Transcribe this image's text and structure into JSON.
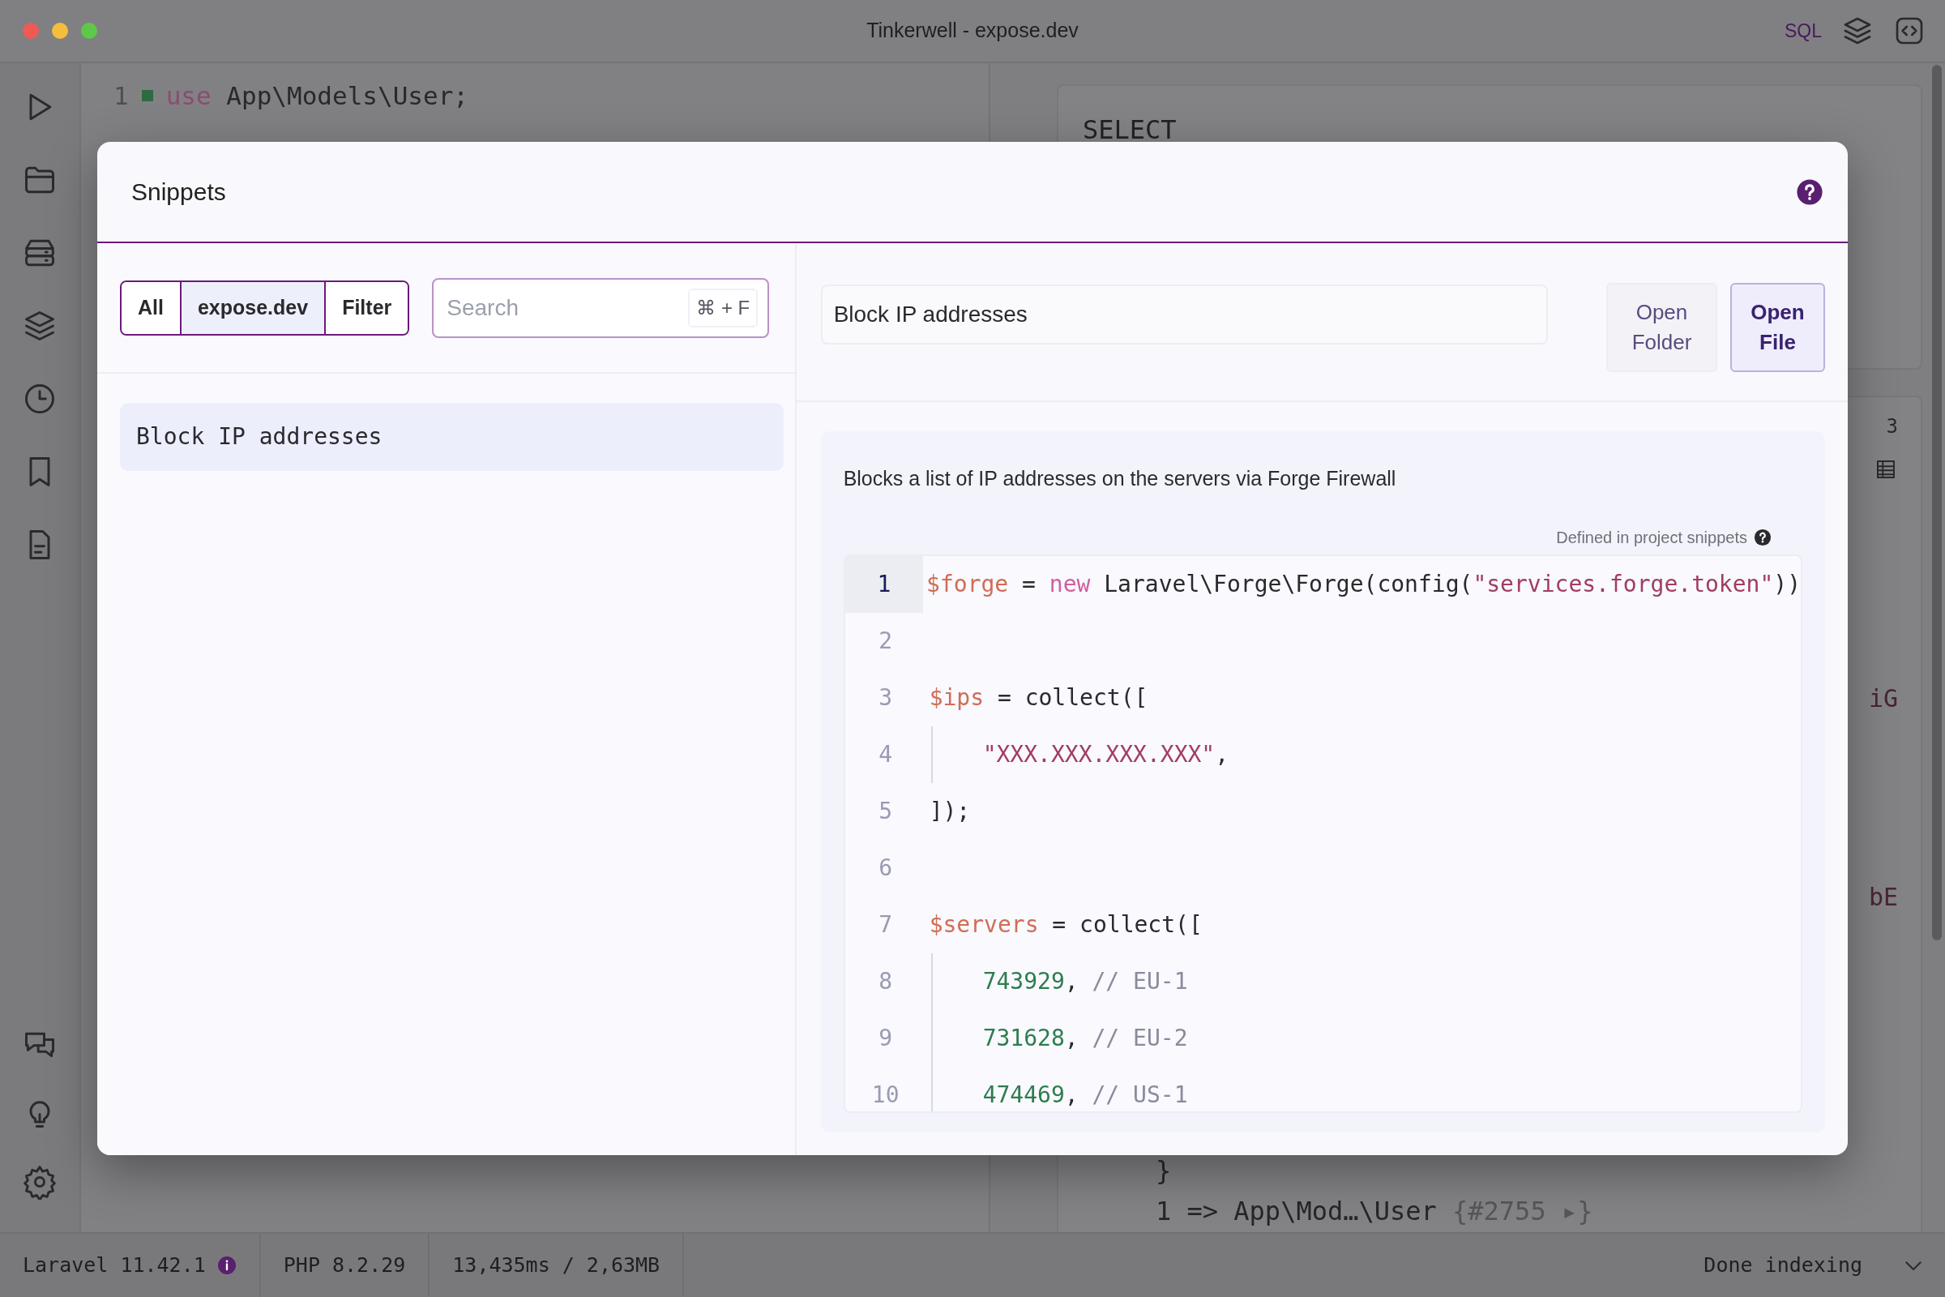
{
  "window": {
    "title": "Tinkerwell - expose.dev",
    "toolbar_label": "SQL"
  },
  "editor": {
    "lines": [
      {
        "number": "1",
        "tokens": [
          {
            "kind": "kw",
            "text": "use"
          },
          {
            "kind": "plain",
            "text": " App\\Models\\User;"
          }
        ]
      }
    ]
  },
  "result_panel": {
    "query": "SELECT",
    "count": "3",
    "fragments": [
      "iG",
      "bE"
    ],
    "output": [
      {
        "tokens": [
          {
            "kind": "plain",
            "text": "}"
          }
        ]
      },
      {
        "tokens": [
          {
            "kind": "plain",
            "text": "1 => App\\Mod…\\User "
          },
          {
            "kind": "muted",
            "text": "{#2755 ▸}"
          }
        ]
      }
    ]
  },
  "modal": {
    "title": "Snippets",
    "filters": [
      {
        "label": "All",
        "selected": false
      },
      {
        "label": "expose.dev",
        "selected": true
      },
      {
        "label": "Filter",
        "selected": false
      }
    ],
    "search": {
      "placeholder": "Search",
      "shortcut": "⌘ + F"
    },
    "snippets": [
      {
        "name": "Block IP addresses",
        "selected": true
      }
    ],
    "detail": {
      "name": "Block IP addresses",
      "buttons": [
        {
          "label": "Open Folder",
          "kind": "secondary"
        },
        {
          "label": "Open File",
          "kind": "primary"
        }
      ],
      "description": "Blocks a list of IP addresses on the servers via Forge Firewall",
      "source_note": "Defined in project snippets",
      "code": [
        {
          "number": "1",
          "active": true,
          "indented": false,
          "tokens": [
            {
              "kind": "var",
              "text": "$forge"
            },
            {
              "kind": "plain",
              "text": " = "
            },
            {
              "kind": "kw",
              "text": "new"
            },
            {
              "kind": "plain",
              "text": " Laravel\\Forge\\Forge(config("
            },
            {
              "kind": "str",
              "text": "\"services.forge.token\""
            },
            {
              "kind": "plain",
              "text": "))"
            }
          ]
        },
        {
          "number": "2",
          "active": false,
          "indented": false
        },
        {
          "number": "3",
          "active": false,
          "indented": false,
          "tokens": [
            {
              "kind": "var",
              "text": "$ips"
            },
            {
              "kind": "plain",
              "text": " = collect(["
            }
          ]
        },
        {
          "number": "4",
          "active": false,
          "indented": true,
          "tokens": [
            {
              "kind": "str",
              "text": "\"XXX.XXX.XXX.XXX\""
            },
            {
              "kind": "plain",
              "text": ","
            }
          ]
        },
        {
          "number": "5",
          "active": false,
          "indented": false,
          "tokens": [
            {
              "kind": "plain",
              "text": "]);"
            }
          ]
        },
        {
          "number": "6",
          "active": false,
          "indented": false
        },
        {
          "number": "7",
          "active": false,
          "indented": false,
          "tokens": [
            {
              "kind": "var",
              "text": "$servers"
            },
            {
              "kind": "plain",
              "text": " = collect(["
            }
          ]
        },
        {
          "number": "8",
          "active": false,
          "indented": true,
          "tokens": [
            {
              "kind": "num",
              "text": "743929"
            },
            {
              "kind": "plain",
              "text": ", "
            },
            {
              "kind": "comment",
              "text": "// EU-1"
            }
          ]
        },
        {
          "number": "9",
          "active": false,
          "indented": true,
          "tokens": [
            {
              "kind": "num",
              "text": "731628"
            },
            {
              "kind": "plain",
              "text": ", "
            },
            {
              "kind": "comment",
              "text": "// EU-2"
            }
          ]
        },
        {
          "number": "10",
          "active": false,
          "indented": true,
          "tokens": [
            {
              "kind": "num",
              "text": "474469"
            },
            {
              "kind": "plain",
              "text": ", "
            },
            {
              "kind": "comment",
              "text": "// US-1"
            }
          ]
        }
      ]
    }
  },
  "status_bar": {
    "items": [
      "Laravel 11.42.1",
      "PHP 8.2.29",
      "13,435ms / 2,63MB"
    ],
    "right": "Done indexing"
  }
}
